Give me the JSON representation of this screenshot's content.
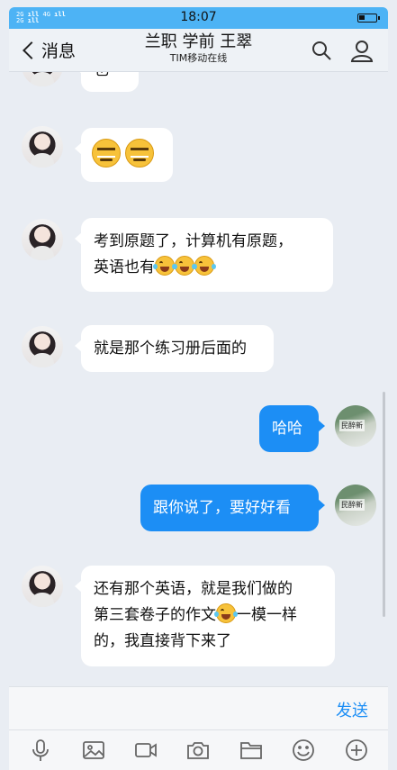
{
  "status_bar": {
    "signal": "2G ıll 4G⁺ıll\n2G ıll",
    "time": "18:07"
  },
  "header": {
    "back_label": "消息",
    "title": "兰职 学前 王翠",
    "subtitle": "TIM移动在线"
  },
  "messages": [
    {
      "side": "in",
      "text": "也",
      "partial": true
    },
    {
      "side": "in",
      "emojis": [
        "sly",
        "sly"
      ]
    },
    {
      "side": "in",
      "line1": "考到原题了，计算机有原题，",
      "line2": "英语也有"
    },
    {
      "side": "in",
      "text": "就是那个练习册后面的"
    },
    {
      "side": "out",
      "text": "哈哈",
      "avatar_text": "民醉新"
    },
    {
      "side": "out",
      "text": "跟你说了，要好好看",
      "avatar_text": "民醉新"
    },
    {
      "side": "in",
      "line1": "还有那个英语，就是我们做的",
      "line2a": "第三套卷子的作文",
      "line2b": "一模一样",
      "line3": "的，我直接背下来了"
    }
  ],
  "input": {
    "send_label": "发送"
  },
  "toolbar": [
    "microphone-icon",
    "image-icon",
    "video-icon",
    "camera-icon",
    "folder-icon",
    "emoji-icon",
    "plus-icon"
  ],
  "colors": {
    "accent": "#1c8ef5",
    "status_bar": "#4db3f5",
    "chat_bg": "#e9edf3"
  }
}
